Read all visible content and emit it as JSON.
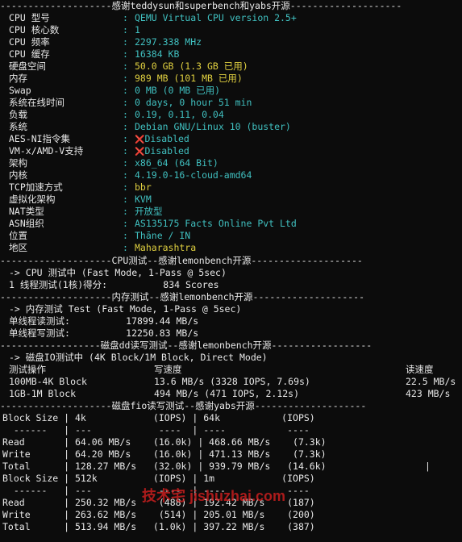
{
  "header_sep": "--------------------感谢teddysun和superbench和yabs开源--------------------",
  "sysinfo": [
    {
      "label": "CPU 型号",
      "value": "QEMU Virtual CPU version 2.5+",
      "color": "cyan"
    },
    {
      "label": "CPU 核心数",
      "value": "1",
      "color": "cyan"
    },
    {
      "label": "CPU 频率",
      "value": "2297.338 MHz",
      "color": "cyan"
    },
    {
      "label": "CPU 缓存",
      "value": "16384 KB",
      "color": "cyan"
    },
    {
      "label": "硬盘空间",
      "value": "50.0 GB (1.3 GB 已用)",
      "color": "yellow"
    },
    {
      "label": "内存",
      "value": "989 MB (101 MB 已用)",
      "color": "yellow"
    },
    {
      "label": "Swap",
      "value": "0 MB (0 MB 已用)",
      "color": "cyan"
    },
    {
      "label": "系统在线时间",
      "value": "0 days, 0 hour 51 min",
      "color": "cyan"
    },
    {
      "label": "负载",
      "value": "0.19, 0.11, 0.04",
      "color": "cyan"
    },
    {
      "label": "系统",
      "value": "Debian GNU/Linux 10 (buster)",
      "color": "cyan"
    },
    {
      "label": "AES-NI指令集",
      "value": "Disabled",
      "color": "cyan",
      "icon": "cross-mark-icon"
    },
    {
      "label": "VM-x/AMD-V支持",
      "value": "Disabled",
      "color": "cyan",
      "icon": "cross-mark-icon"
    },
    {
      "label": "架构",
      "value": "x86_64 (64 Bit)",
      "color": "cyan"
    },
    {
      "label": "内核",
      "value": "4.19.0-16-cloud-amd64",
      "color": "cyan"
    },
    {
      "label": "TCP加速方式",
      "value": "bbr",
      "color": "yellow"
    },
    {
      "label": "虚拟化架构",
      "value": "KVM",
      "color": "cyan"
    },
    {
      "label": "NAT类型",
      "value": "开放型",
      "color": "cyan"
    },
    {
      "label": "ASN组织",
      "value": "AS135175 Facts Online Pvt Ltd",
      "color": "cyan"
    },
    {
      "label": "位置",
      "value": "Thāne / IN",
      "color": "cyan"
    },
    {
      "label": "地区",
      "value": "Maharashtra",
      "color": "yellow"
    }
  ],
  "colon": ":",
  "cpu_sep": "--------------------CPU测试--感谢lemonbench开源--------------------",
  "cpu_lines": [
    "-> CPU 测试中 (Fast Mode, 1-Pass @ 5sec)",
    "1 线程测试(1核)得分:          834 Scores"
  ],
  "mem_sep": "--------------------内存测试--感谢lemonbench开源--------------------",
  "mem_lines": [
    "-> 内存测试 Test (Fast Mode, 1-Pass @ 5sec)",
    "单线程读测试:          17899.44 MB/s",
    "单线程写测试:          12250.83 MB/s"
  ],
  "dd_sep": "------------------磁盘dd读写测试--感谢lemonbench开源------------------",
  "dd_intro": "-> 磁盘IO测试中 (4K Block/1M Block, Direct Mode)",
  "dd_headers": [
    "测试操作",
    "写速度",
    "读速度"
  ],
  "dd_rows": [
    [
      "100MB-4K Block",
      "13.6 MB/s (3328 IOPS, 7.69s)",
      "22.5 MB/s"
    ],
    [
      "1GB-1M Block",
      "494 MB/s (471 IOPS, 2.12s)",
      "423 MB/s"
    ]
  ],
  "fio_sep": "--------------------磁盘fio读写测试--感谢yabs开源--------------------",
  "fio_lines": [
    "Block Size | 4k            (IOPS) | 64k           (IOPS)",
    "  ------   | ---            ----  | ----           ----",
    "Read       | 64.06 MB/s    (16.0k) | 468.66 MB/s    (7.3k)",
    "Write      | 64.20 MB/s    (16.0k) | 471.13 MB/s    (7.3k)",
    "Total      | 128.27 MB/s   (32.0k) | 939.79 MB/s   (14.6k)",
    "Block Size | 512k          (IOPS) | 1m            (IOPS)",
    "  ------   | ---            ----  | ----           ----",
    "Read       | 250.32 MB/s    (488) | 192.42 MB/s    (187)",
    "Write      | 263.62 MB/s    (514) | 205.01 MB/s    (200)",
    "Total      | 513.94 MB/s   (1.0k) | 397.22 MB/s    (387)"
  ],
  "cursor": "|",
  "watermark": "技术宅 jishuzhai.com",
  "colors": {
    "cyan": "#40c0c0",
    "yellow": "#e0d040",
    "white": "#e8e8e8",
    "red": "#e05050",
    "background": "#0c0c0c"
  }
}
